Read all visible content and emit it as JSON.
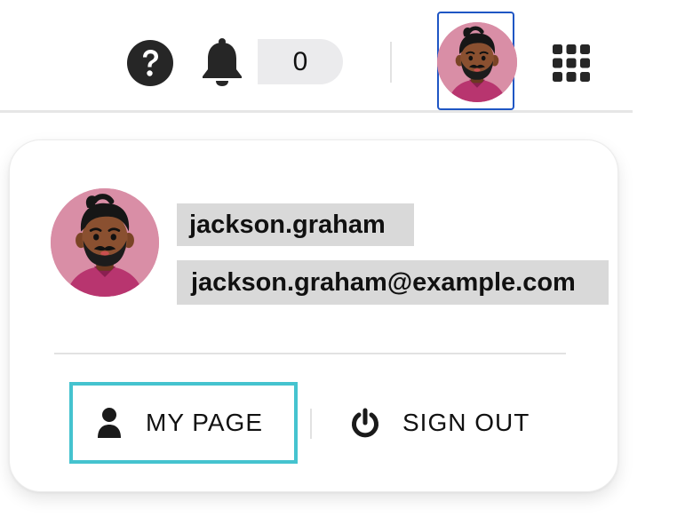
{
  "header": {
    "help_icon": "help-circle-icon",
    "notification_icon": "bell-icon",
    "notification_count": "0",
    "avatar_icon": "user-avatar",
    "apps_icon": "apps-grid-icon"
  },
  "profile_menu": {
    "username": "jackson.graham",
    "email": "jackson.graham@example.com",
    "my_page_label": "MY PAGE",
    "my_page_icon": "user-icon",
    "sign_out_label": "SIGN OUT",
    "sign_out_icon": "power-icon"
  },
  "colors": {
    "focus_outline_avatar": "#1f56c4",
    "focus_outline_my_page": "#45c3cf",
    "avatar_background": "#d98ea6",
    "text_highlight": "#d9d9d9"
  }
}
